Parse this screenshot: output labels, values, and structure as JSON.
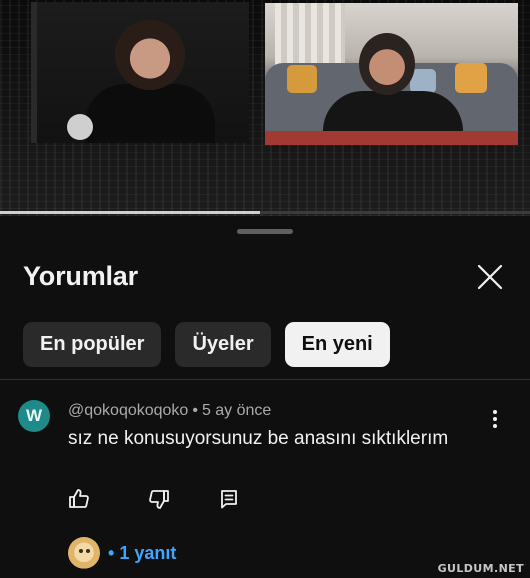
{
  "video": {
    "progress": 0.49
  },
  "comments_sheet": {
    "title": "Yorumlar",
    "close_icon": "close-icon",
    "filters": [
      {
        "label": "En popüler",
        "selected": false
      },
      {
        "label": "Üyeler",
        "selected": false
      },
      {
        "label": "En yeni",
        "selected": true
      }
    ]
  },
  "comment": {
    "avatar_letter": "W",
    "avatar_color": "#1e8a8a",
    "author": "@qokoqokoqoko",
    "separator": "•",
    "time": "5 ay önce",
    "text": "sız ne konusuyorsunuz be anasını sıktıklerım",
    "actions": {
      "like_icon": "thumbs-up-icon",
      "dislike_icon": "thumbs-down-icon",
      "reply_icon": "reply-comment-icon"
    },
    "more_icon": "more-vertical-icon",
    "replies": {
      "bullet": "•",
      "label": "1 yanıt",
      "color": "#3ea6ff"
    }
  },
  "watermark": "GULDUM.NET"
}
